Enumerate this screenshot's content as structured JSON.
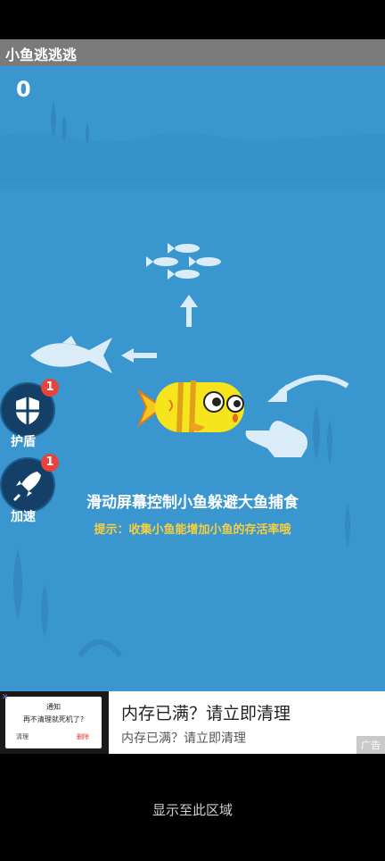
{
  "app": {
    "title": "小鱼逃逃逃"
  },
  "game": {
    "score": "0",
    "instruction": "滑动屏幕控制小鱼躲避大鱼捕食",
    "hint": "提示：收集小鱼能增加小鱼的存活率哦"
  },
  "powerups": [
    {
      "label": "护盾",
      "count": "1",
      "icon": "shield-icon"
    },
    {
      "label": "加速",
      "count": "1",
      "icon": "rocket-icon"
    }
  ],
  "ad": {
    "thumb_title": "通知",
    "thumb_text": "再不清理就死机了?",
    "thumb_left": "清理",
    "thumb_right": "删除",
    "headline": "内存已满？请立即清理",
    "subline": "内存已满？请立即清理",
    "tag": "广告"
  },
  "bottom": {
    "message": "显示至此区域"
  },
  "colors": {
    "water": "#3a96cf",
    "player_fish": "#f6e51c",
    "badge": "#e6443a",
    "hint": "#f7cf3e"
  }
}
